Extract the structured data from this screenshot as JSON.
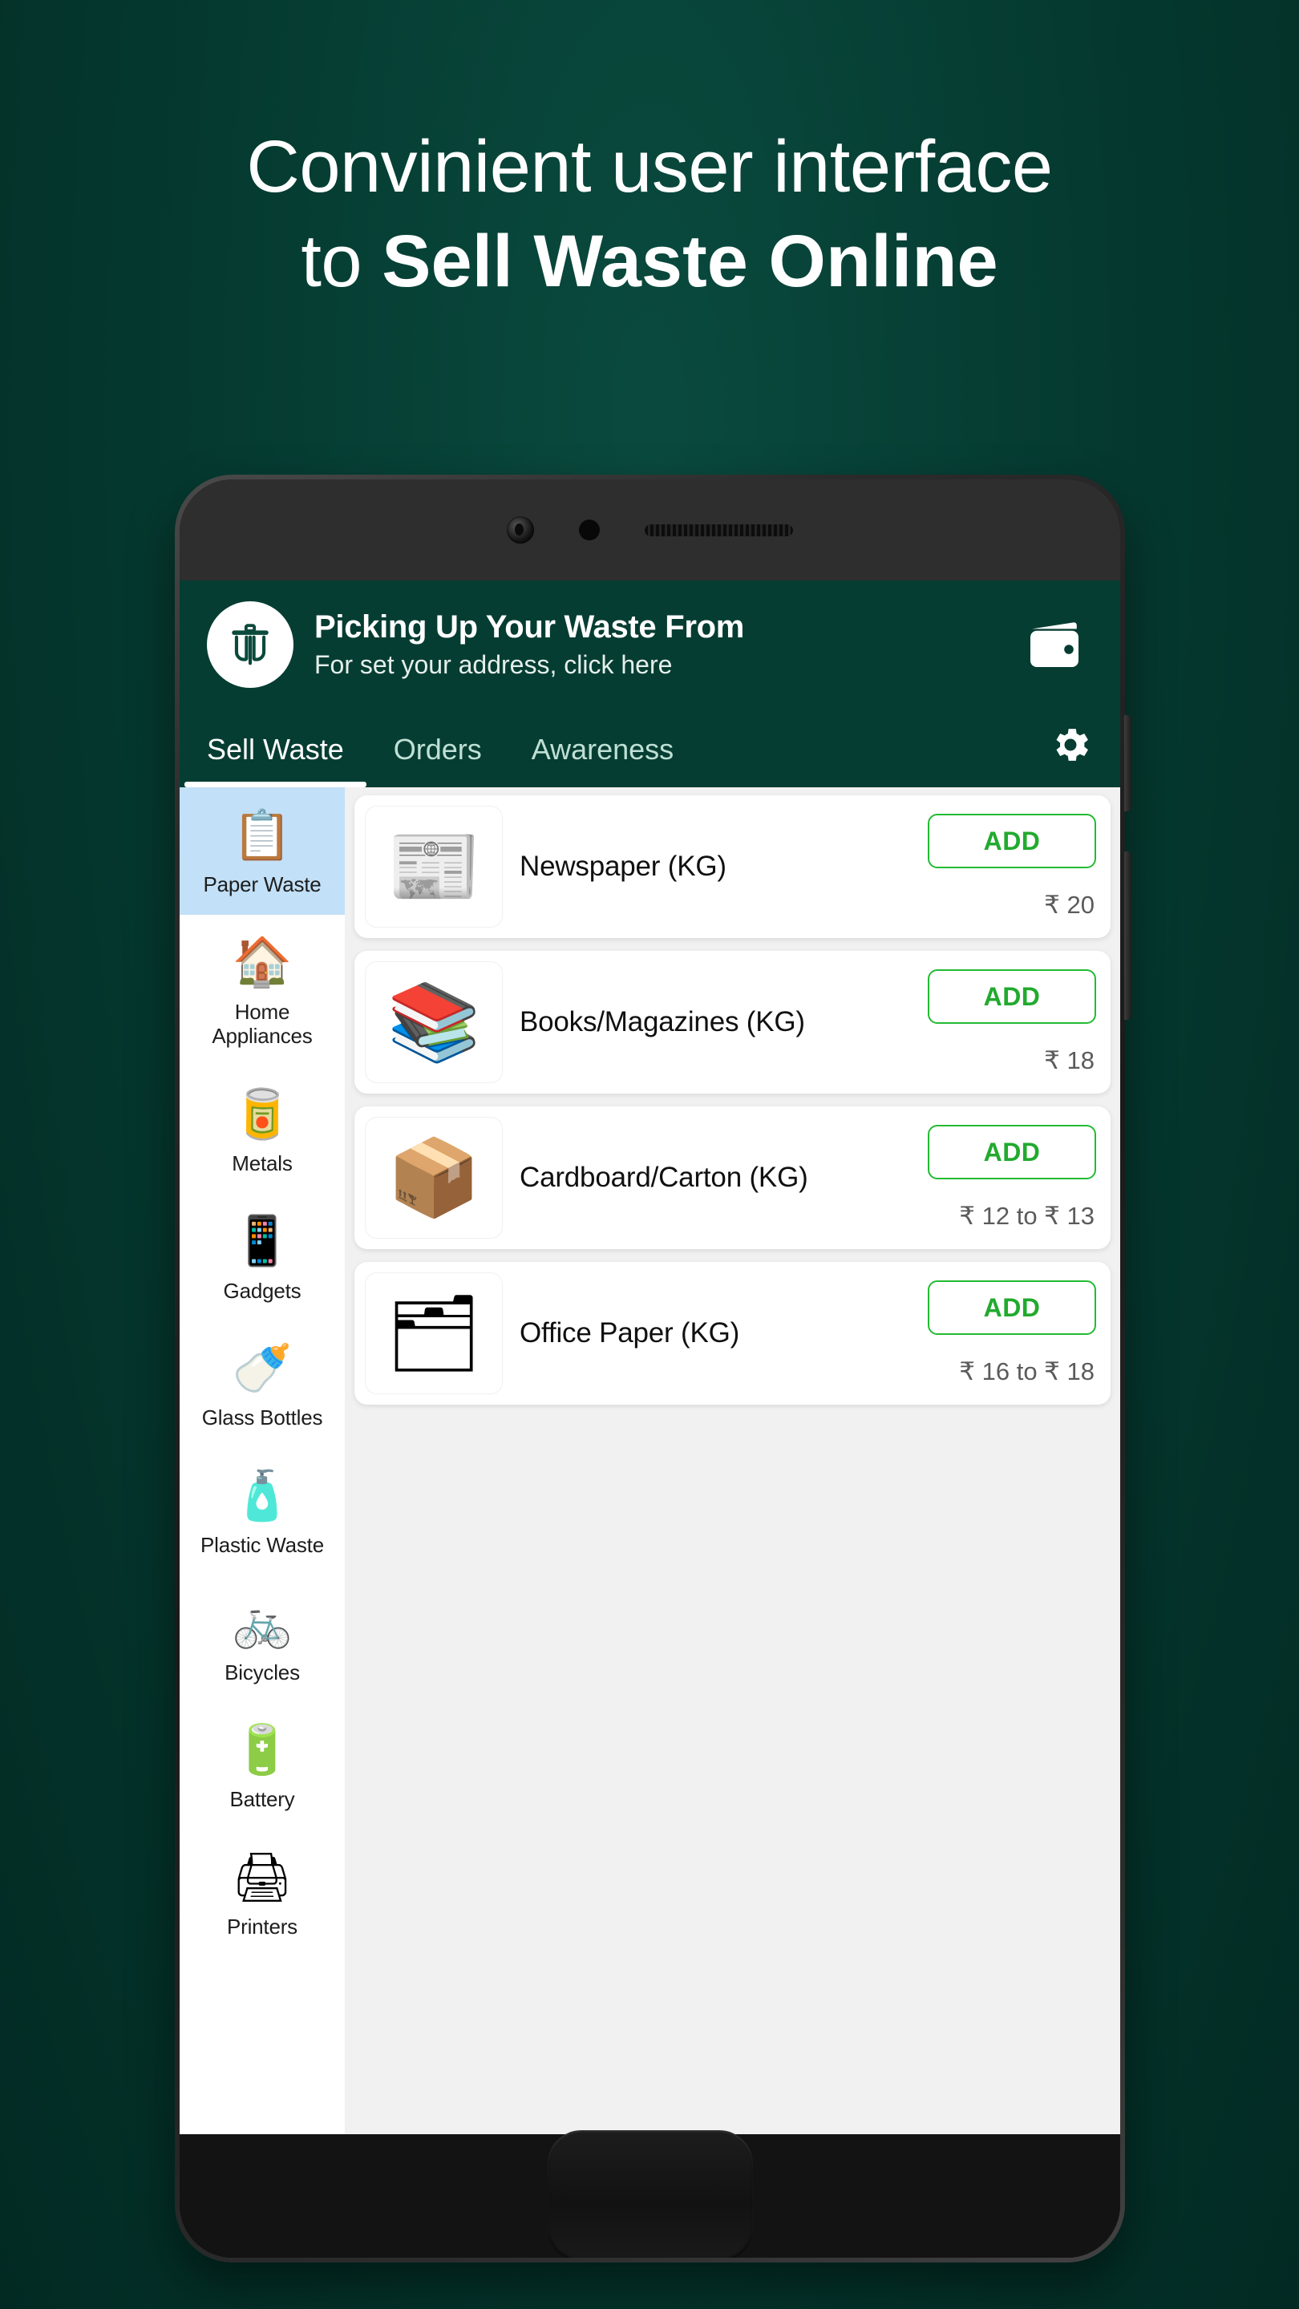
{
  "poster": {
    "headline_line1": "Convinient user interface",
    "headline_line2_prefix": "to ",
    "headline_line2_bold": "Sell Waste Online",
    "background_color": "#053b31"
  },
  "app": {
    "header": {
      "logo_icon": "trash-bin-icon",
      "title": "Picking Up Your Waste From",
      "subtitle": "For set your address, click here",
      "wallet_icon": "wallet-icon",
      "background_color": "#063d32"
    },
    "tabs": {
      "items": [
        {
          "label": "Sell Waste",
          "active": true
        },
        {
          "label": "Orders",
          "active": false
        },
        {
          "label": "Awareness",
          "active": false
        }
      ],
      "settings_icon": "gear-icon"
    },
    "sidebar": {
      "selected_color": "#c2e0f7",
      "items": [
        {
          "label": "Paper Waste",
          "icon": "📋",
          "selected": true
        },
        {
          "label": "Home Appliances",
          "icon": "🏠",
          "selected": false
        },
        {
          "label": "Metals",
          "icon": "🥫",
          "selected": false
        },
        {
          "label": "Gadgets",
          "icon": "📱",
          "selected": false
        },
        {
          "label": "Glass Bottles",
          "icon": "🍼",
          "selected": false
        },
        {
          "label": "Plastic Waste",
          "icon": "🧴",
          "selected": false
        },
        {
          "label": "Bicycles",
          "icon": "🚲",
          "selected": false
        },
        {
          "label": "Battery",
          "icon": "🔋",
          "selected": false
        },
        {
          "label": "Printers",
          "icon": "🖨",
          "selected": false
        }
      ]
    },
    "products": {
      "add_label": "ADD",
      "accent_color": "#22bb33",
      "items": [
        {
          "name": "Newspaper (KG)",
          "price": "₹ 20",
          "icon": "📰"
        },
        {
          "name": "Books/Magazines (KG)",
          "price": "₹ 18",
          "icon": "📚"
        },
        {
          "name": "Cardboard/Carton (KG)",
          "price": "₹ 12 to ₹ 13",
          "icon": "📦"
        },
        {
          "name": "Office Paper (KG)",
          "price": "₹ 16 to ₹ 18",
          "icon": "🗂"
        }
      ]
    }
  }
}
